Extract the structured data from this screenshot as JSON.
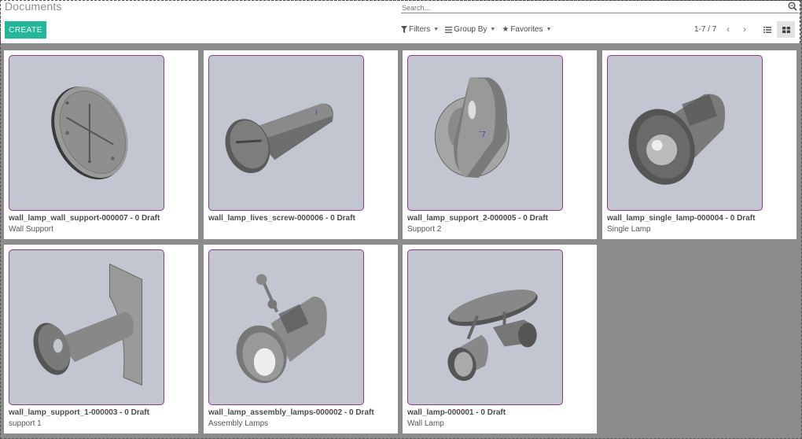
{
  "header": {
    "title": "Documents",
    "create_label": "CREATE",
    "search_placeholder": "Search..."
  },
  "search_options": [
    {
      "label": "Filters",
      "icon": "filter-icon"
    },
    {
      "label": "Group By",
      "icon": "list-icon"
    },
    {
      "label": "Favorites",
      "icon": "star-icon"
    }
  ],
  "pager": {
    "text": "1-7 / 7",
    "prev_icon": "chevron-left-icon",
    "next_icon": "chevron-right-icon"
  },
  "views": [
    {
      "name": "list",
      "icon": "list-view-icon",
      "active": false
    },
    {
      "name": "kanban",
      "icon": "kanban-view-icon",
      "active": true
    }
  ],
  "colors": {
    "accent": "#21b799",
    "thumb_border": "#8a3c7d",
    "thumb_bg": "#c2c6d0",
    "background": "#8c8c8c"
  },
  "cards": [
    {
      "name": "wall_lamp_wall_support-000007 - 0 Draft",
      "description": "Wall Support",
      "image": "wall-support-disc"
    },
    {
      "name": "wall_lamp_lives_screw-000006 - 0 Draft",
      "description": "",
      "image": "lives-screw"
    },
    {
      "name": "wall_lamp_support_2-000005 - 0 Draft",
      "description": "Support 2",
      "image": "support-2"
    },
    {
      "name": "wall_lamp_single_lamp-000004 - 0 Draft",
      "description": "Single Lamp",
      "image": "single-lamp"
    },
    {
      "name": "wall_lamp_support_1-000003 - 0 Draft",
      "description": "support 1",
      "image": "support-1"
    },
    {
      "name": "wall_lamp_assembly_lamps-000002 - 0 Draft",
      "description": "Assembly Lamps",
      "image": "assembly-lamps"
    },
    {
      "name": "wall_lamp-000001 - 0 Draft",
      "description": "Wall Lamp",
      "image": "wall-lamp"
    }
  ]
}
